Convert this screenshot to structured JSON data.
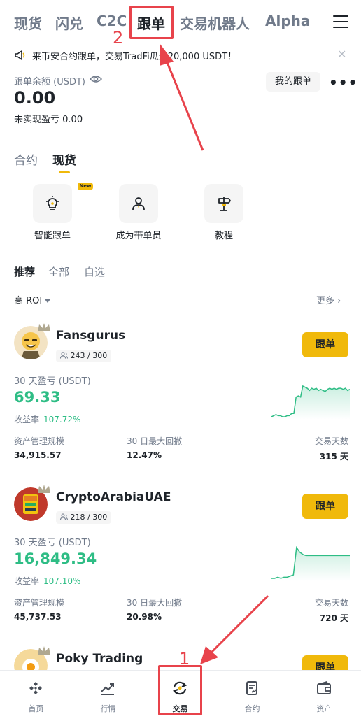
{
  "top_tabs": [
    {
      "label": "现货"
    },
    {
      "label": "闪兑"
    },
    {
      "label": "C2C"
    },
    {
      "label": "跟单"
    },
    {
      "label": "交易机器人"
    },
    {
      "label": "Alpha"
    }
  ],
  "banner": {
    "text": "来币安合约跟单，交易TradFi瓜分20,000 USDT！"
  },
  "balance": {
    "label": "跟单余额 (USDT)",
    "value": "0.00",
    "pnl_label": "未实现盈亏",
    "pnl_value": "0.00",
    "my_copy_label": "我的跟单"
  },
  "segments": [
    {
      "label": "合约"
    },
    {
      "label": "现货"
    }
  ],
  "features": [
    {
      "label": "智能跟单",
      "badge": "New"
    },
    {
      "label": "成为带单员"
    },
    {
      "label": "教程"
    }
  ],
  "subtabs": [
    {
      "label": "推荐"
    },
    {
      "label": "全部"
    },
    {
      "label": "自选"
    }
  ],
  "sort": {
    "label": "高 ROI",
    "more": "更多 ›"
  },
  "stat_labels": {
    "aum": "资产管理规模",
    "mdd": "30 日最大回撤",
    "days": "交易天数"
  },
  "traders": [
    {
      "name": "Fansgurus",
      "followers": "243 / 300",
      "follow": "跟单",
      "pnl_label": "30 天盈亏 (USDT)",
      "pnl": "69.33",
      "roi_label": "收益率",
      "roi": "107.72%",
      "aum": "34,915.57",
      "mdd": "12.47%",
      "days": "315 天",
      "spark": [
        2,
        3,
        4,
        3,
        3,
        2,
        2,
        3,
        3,
        5,
        5,
        20,
        21,
        20,
        30,
        29,
        28,
        26,
        28,
        27,
        28,
        26,
        27,
        26,
        25,
        27,
        28,
        27,
        28,
        27,
        28,
        28,
        27,
        28,
        26,
        27
      ]
    },
    {
      "name": "CryptoArabiaUAE",
      "followers": "218 / 300",
      "follow": "跟单",
      "pnl_label": "30 天盈亏 (USDT)",
      "pnl": "16,849.34",
      "roi_label": "收益率",
      "roi": "107.10%",
      "aum": "45,737.53",
      "mdd": "20.98%",
      "days": "720 天",
      "spark": [
        1,
        1,
        2,
        1,
        2,
        2,
        3,
        4,
        28,
        24,
        22,
        21,
        21,
        21,
        21,
        21,
        21,
        21,
        21,
        21,
        21,
        21,
        21,
        21,
        21,
        21
      ]
    },
    {
      "name": "Poky Trading",
      "follow": "跟单"
    }
  ],
  "bottom_nav": [
    {
      "label": "首页"
    },
    {
      "label": "行情"
    },
    {
      "label": "交易"
    },
    {
      "label": "合约"
    },
    {
      "label": "资产"
    }
  ],
  "annotations": [
    {
      "label": "1"
    },
    {
      "label": "2"
    }
  ],
  "colors": {
    "accent": "#F0B90B",
    "positive": "#2EBD85",
    "annotation": "#E8434B"
  }
}
